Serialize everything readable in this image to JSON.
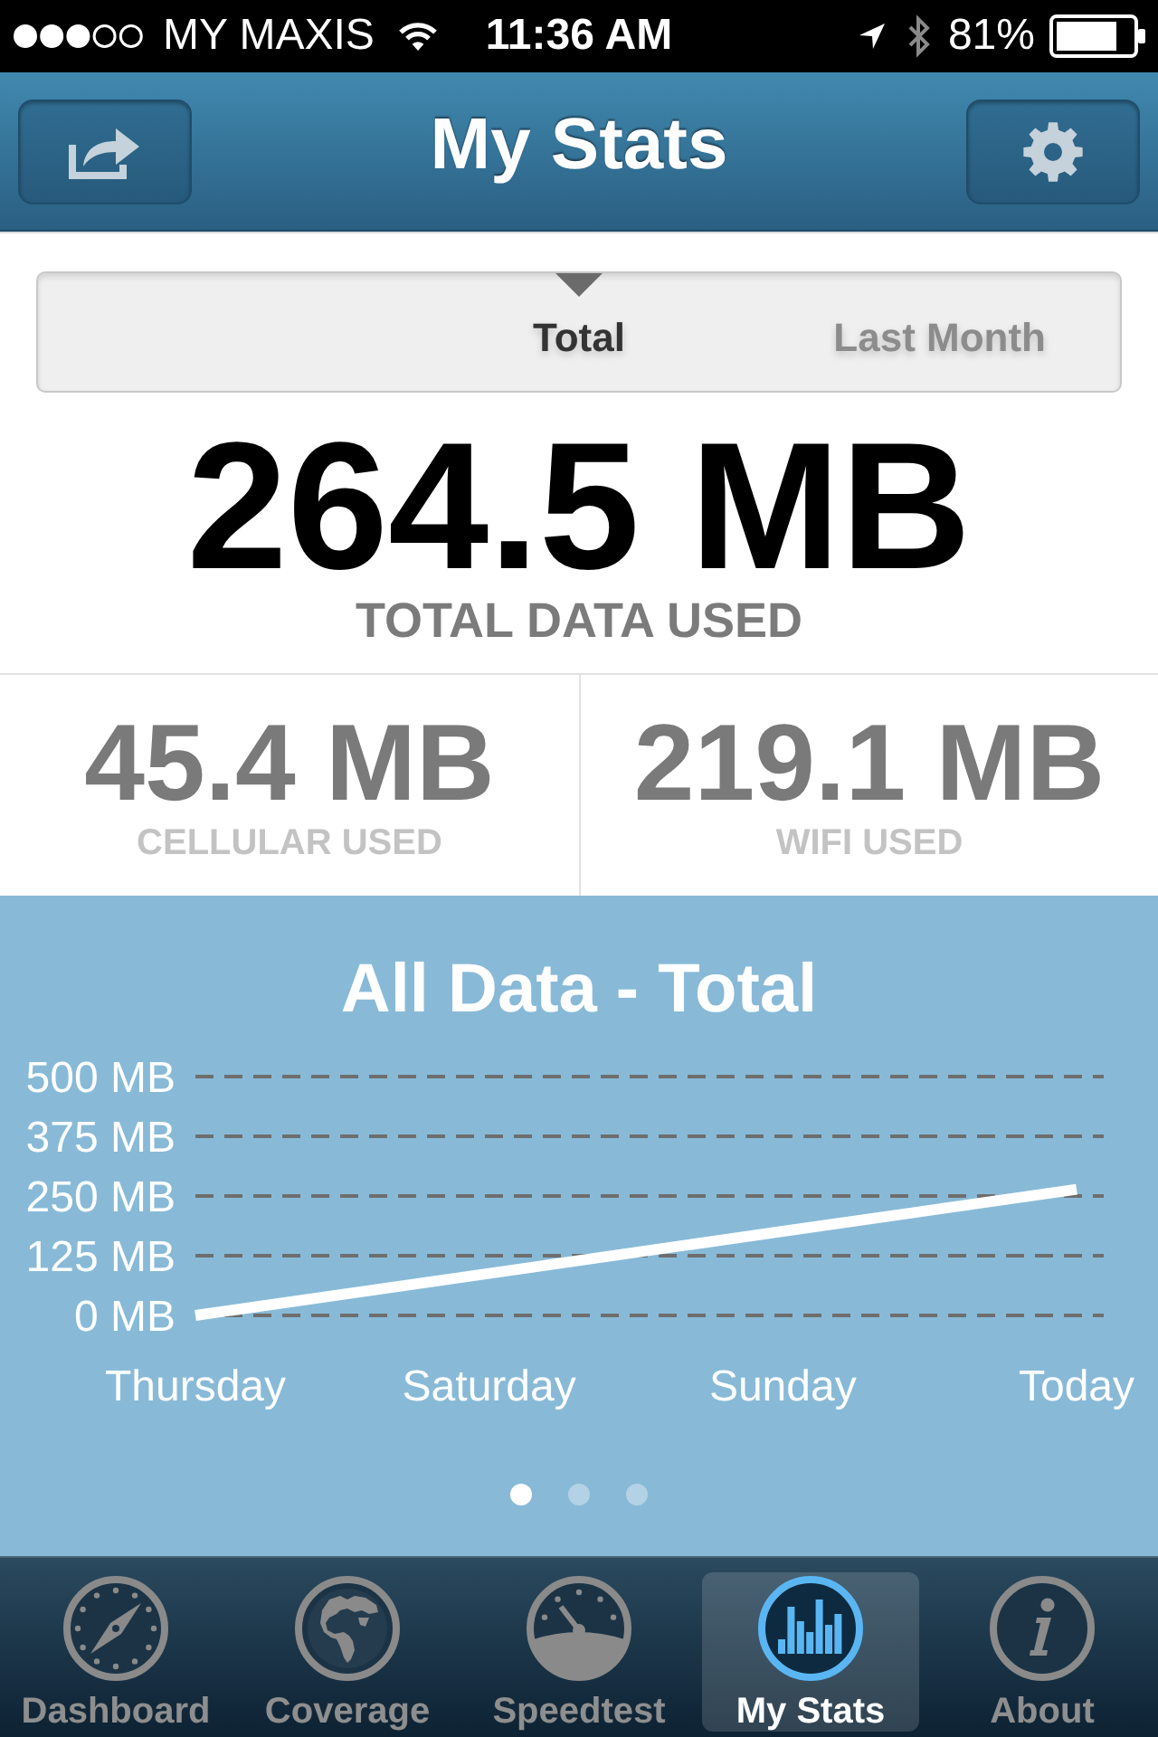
{
  "status_bar": {
    "carrier": "MY MAXIS",
    "time": "11:36 AM",
    "battery": "81%"
  },
  "nav_bar": {
    "title": "My Stats"
  },
  "period_tabs": [
    {
      "label": "Total",
      "selected": true
    },
    {
      "label": "Last Month",
      "selected": false
    }
  ],
  "total": {
    "value": "264.5 MB",
    "label": "TOTAL DATA USED"
  },
  "breakdown": [
    {
      "value": "45.4 MB",
      "label": "CELLULAR USED"
    },
    {
      "value": "219.1 MB",
      "label": "WIFI USED"
    }
  ],
  "chart_panel": {
    "chart_data": {
      "type": "line",
      "title": "All Data - Total",
      "categories": [
        "Thursday",
        "Saturday",
        "Sunday",
        "Today"
      ],
      "series": [
        {
          "color": "#ffffff",
          "values": [
            0,
            88,
            176,
            264
          ]
        }
      ],
      "ylim": [
        0,
        500
      ],
      "yticks": [
        {
          "value": 0,
          "label": "0 MB"
        },
        {
          "value": 125,
          "label": "125 MB"
        },
        {
          "value": 250,
          "label": "250 MB"
        },
        {
          "value": 375,
          "label": "375 MB"
        },
        {
          "value": 500,
          "label": "500 MB"
        }
      ],
      "grid": true
    },
    "page_dots": [
      {
        "selected": true
      },
      {
        "selected": false
      },
      {
        "selected": false
      }
    ]
  },
  "tab_bar": [
    {
      "label": "Dashboard",
      "selected": false
    },
    {
      "label": "Coverage",
      "selected": false
    },
    {
      "label": "Speedtest",
      "selected": false
    },
    {
      "label": "My Stats",
      "selected": true
    },
    {
      "label": "About",
      "selected": false
    }
  ]
}
